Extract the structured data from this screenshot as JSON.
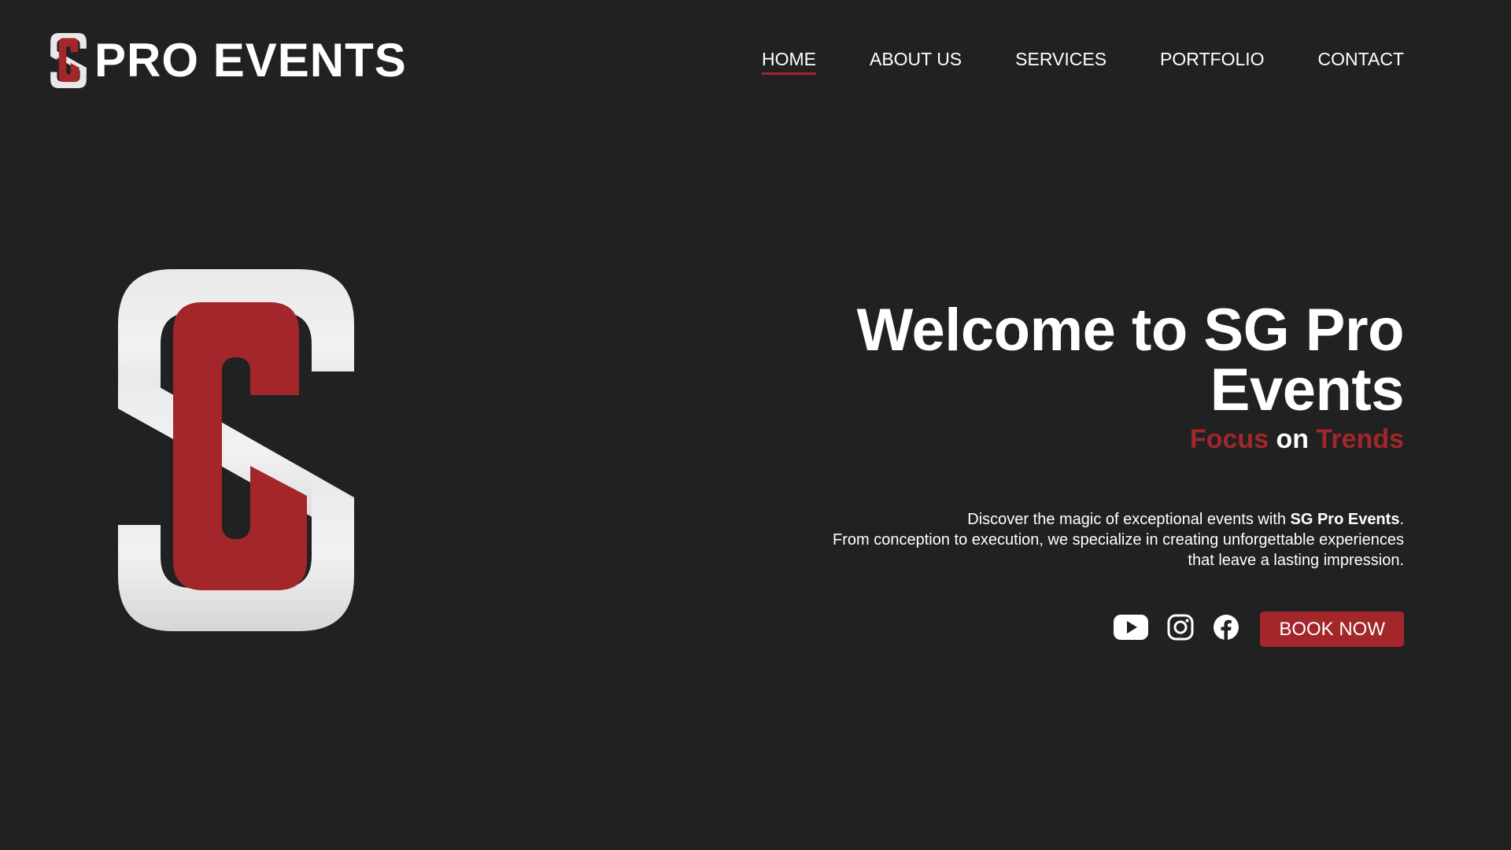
{
  "brand": {
    "name": "PRO EVENTS",
    "colors": {
      "accent": "#a3262b",
      "background": "#212121",
      "logo_light": "#e8e8e8",
      "text": "#ffffff"
    }
  },
  "nav": {
    "items": [
      {
        "label": "HOME",
        "active": true
      },
      {
        "label": "ABOUT US",
        "active": false
      },
      {
        "label": "SERVICES",
        "active": false
      },
      {
        "label": "PORTFOLIO",
        "active": false
      },
      {
        "label": "CONTACT",
        "active": false
      }
    ]
  },
  "hero": {
    "title": "Welcome to SG Pro Events",
    "tagline": {
      "part1": "Focus",
      "part2": "on",
      "part3": "Trends"
    },
    "description": {
      "line1_prefix": "Discover the magic of exceptional events with ",
      "line1_bold": "SG Pro Events",
      "line1_suffix": ".",
      "line2": "From conception to execution, we specialize in creating unforgettable experiences",
      "line3": "that leave a lasting impression."
    },
    "social": [
      {
        "icon": "youtube-icon"
      },
      {
        "icon": "instagram-icon"
      },
      {
        "icon": "facebook-icon"
      }
    ],
    "cta_label": "BOOK NOW"
  }
}
